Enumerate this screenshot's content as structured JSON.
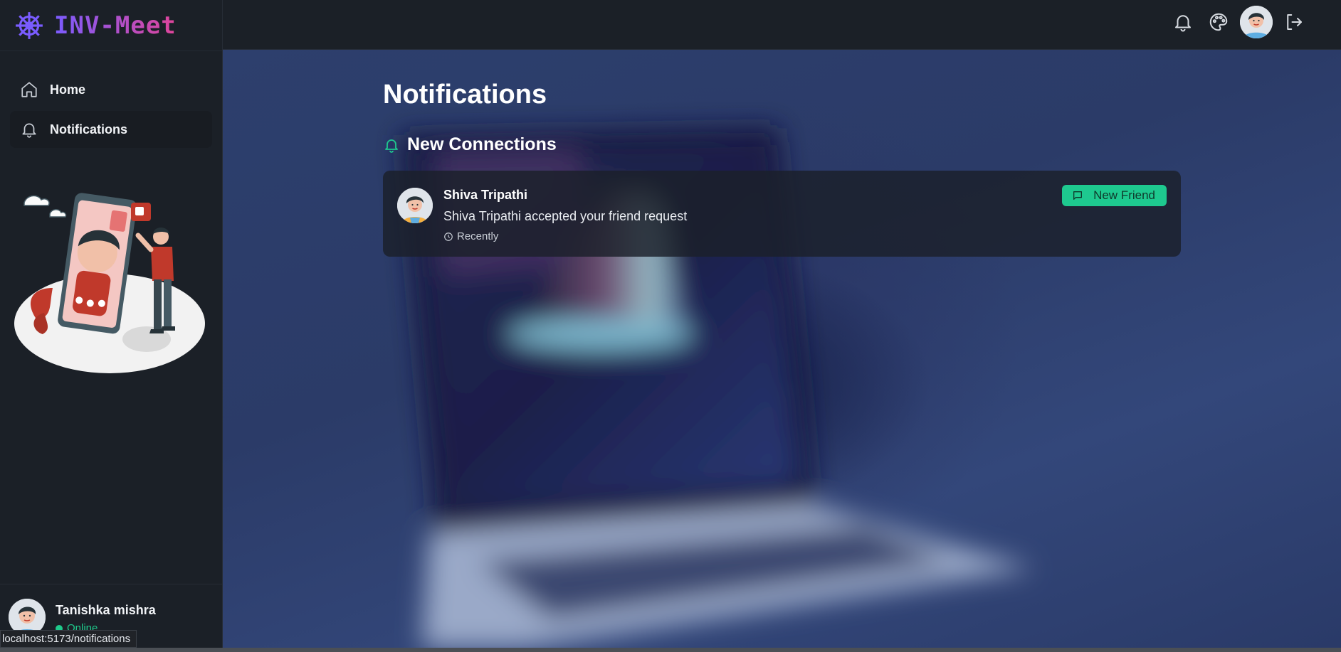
{
  "app": {
    "name": "INV-Meet",
    "logo_icon": "dharma-wheel-icon"
  },
  "sidebar": {
    "items": [
      {
        "label": "Home",
        "icon": "home-icon",
        "active": false
      },
      {
        "label": "Notifications",
        "icon": "bell-icon",
        "active": true
      }
    ],
    "illustration": "video-call-illustration",
    "profile": {
      "name": "Tanishka mishra",
      "status": "Online"
    }
  },
  "header": {
    "actions": [
      "bell-icon",
      "palette-icon",
      "avatar",
      "logout-icon"
    ]
  },
  "main": {
    "title": "Notifications",
    "section": {
      "icon": "bell-icon",
      "label": "New Connections"
    },
    "notifications": [
      {
        "name": "Shiva Tripathi",
        "message": "Shiva Tripathi accepted your friend request",
        "time": "Recently",
        "badge": "New Friend"
      }
    ]
  },
  "status_bar": {
    "url": "localhost:5173/notifications"
  },
  "colors": {
    "accent_green": "#1ec98f",
    "brand_purple": "#7b5cff",
    "brand_pink": "#e0459a",
    "sidebar_bg": "#1b2027"
  }
}
